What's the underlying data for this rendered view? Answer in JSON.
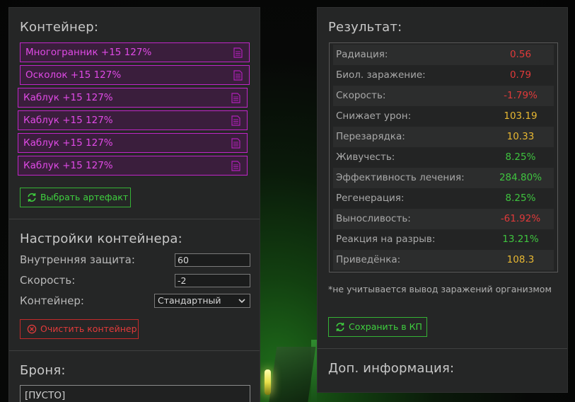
{
  "container": {
    "title": "Контейнер:",
    "artifacts": [
      {
        "label": "Многогранник +15 127%"
      },
      {
        "label": "Осколок +15 127%"
      },
      {
        "label": "Каблук +15 127%"
      },
      {
        "label": "Каблук +15 127%"
      },
      {
        "label": "Каблук +15 127%"
      },
      {
        "label": "Каблук +15 127%"
      }
    ],
    "select_button": "Выбрать артефакт"
  },
  "settings": {
    "title": "Настройки контейнера:",
    "inner_protection_label": "Внутренняя защита:",
    "inner_protection_value": "60",
    "speed_label": "Скорость:",
    "speed_value": "-2",
    "container_label": "Контейнер:",
    "container_selected": "Стандартный",
    "clear_button": "Очистить контейнер"
  },
  "armor": {
    "title": "Броня:",
    "slot": "[ПУСТО]"
  },
  "results": {
    "title": "Результат:",
    "stats": [
      {
        "name": "Радиация:",
        "value": "0.56",
        "color": "#e03a3a"
      },
      {
        "name": "Биол. заражение:",
        "value": "0.79",
        "color": "#e03a3a"
      },
      {
        "name": "Скорость:",
        "value": "-1.79%",
        "color": "#e03a3a"
      },
      {
        "name": "Снижает урон:",
        "value": "103.19",
        "color": "#e8b832"
      },
      {
        "name": "Перезарядка:",
        "value": "10.33",
        "color": "#e8b832"
      },
      {
        "name": "Живучесть:",
        "value": "8.25%",
        "color": "#3fc43f"
      },
      {
        "name": "Эффективность лечения:",
        "value": "284.80%",
        "color": "#3fc43f"
      },
      {
        "name": "Регенерация:",
        "value": "8.25%",
        "color": "#3fc43f"
      },
      {
        "name": "Выносливость:",
        "value": "-61.92%",
        "color": "#e03a3a"
      },
      {
        "name": "Реакция на разрыв:",
        "value": "13.21%",
        "color": "#3fc43f"
      },
      {
        "name": "Приведёнка:",
        "value": "108.3",
        "color": "#e8b832"
      }
    ],
    "note": "*не учитывается вывод заражений организмом",
    "save_button": "Сохранить в КП"
  },
  "extra": {
    "title": "Доп. информация:"
  },
  "colors": {
    "artifact_border": "#c026c8",
    "artifact_text": "#e04ae6",
    "accent_green": "#35b335",
    "accent_red": "#c42a2a"
  }
}
